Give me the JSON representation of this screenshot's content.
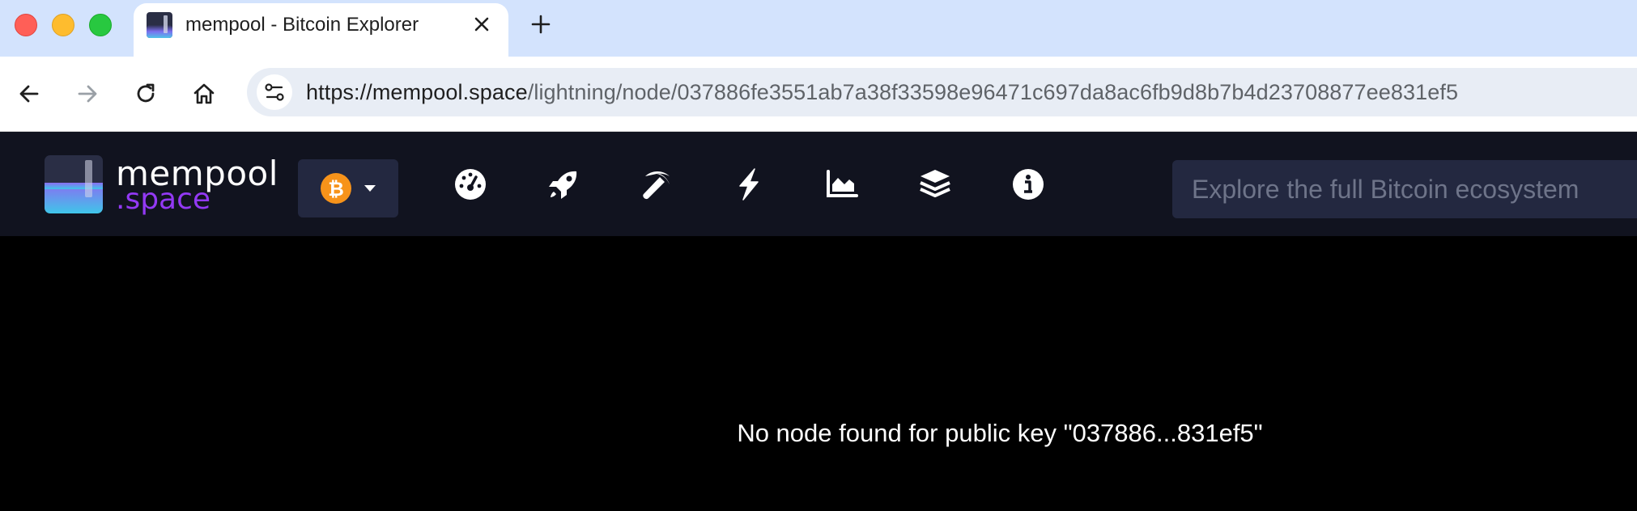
{
  "browser": {
    "tab_title": "mempool - Bitcoin Explorer",
    "url_host": "https://mempool.space",
    "url_path": "/lightning/node/037886fe3551ab7a38f33598e96471c697da8ac6fb9d8b7b4d23708877ee831ef5"
  },
  "header": {
    "logo_line1": "mempool",
    "logo_line2": ".space",
    "network_icon": "bitcoin-icon",
    "nav_icons": [
      "dashboard-icon",
      "rocket-icon",
      "pickaxe-icon",
      "lightning-icon",
      "chart-icon",
      "layers-icon",
      "info-icon"
    ],
    "search_placeholder": "Explore the full Bitcoin ecosystem"
  },
  "main": {
    "message": "No node found for public key \"037886...831ef5\""
  },
  "colors": {
    "header_bg": "#11131f",
    "accent_purple": "#9339f4",
    "bitcoin_orange": "#f7931a",
    "tabstrip_bg": "#d3e3fd"
  }
}
